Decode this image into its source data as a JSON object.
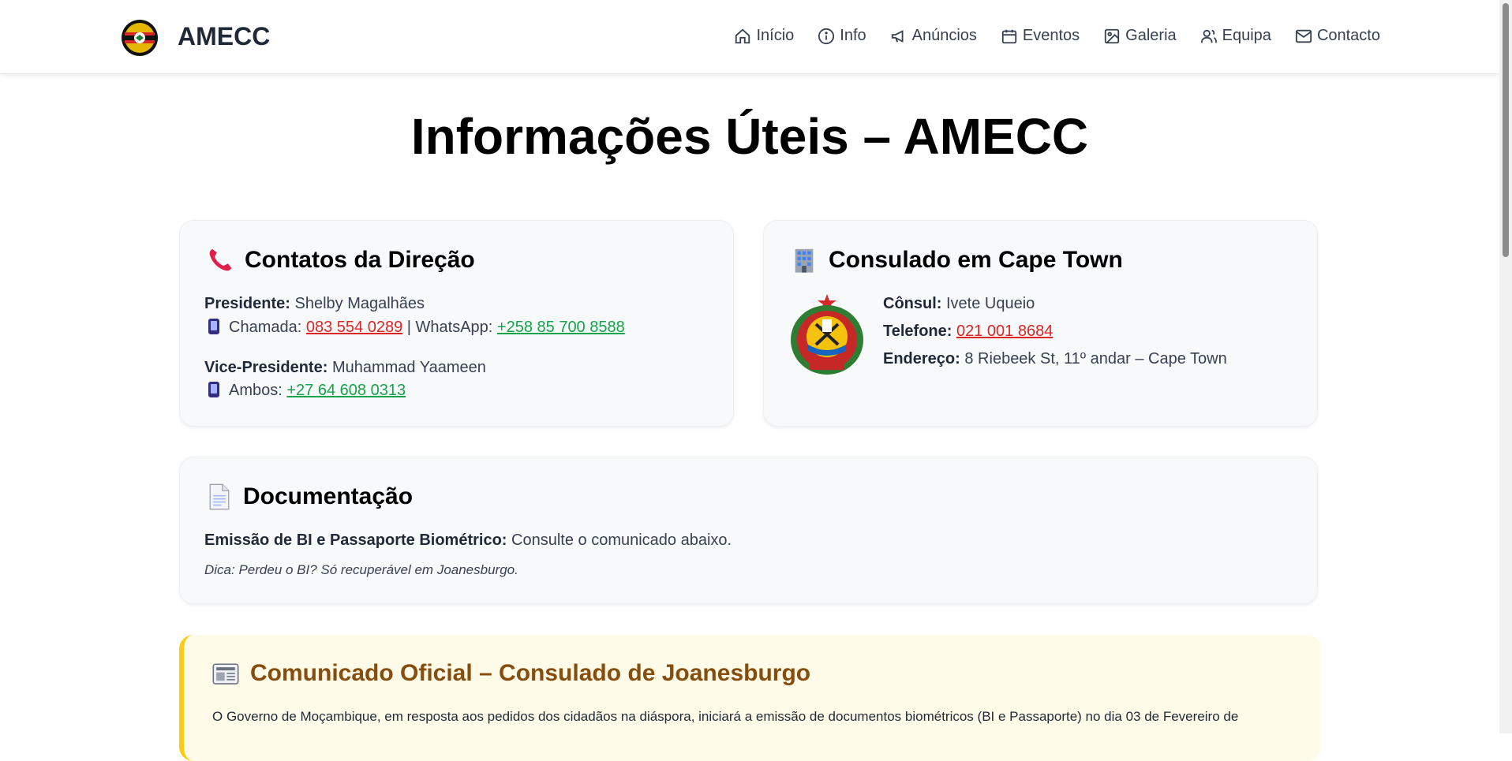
{
  "header": {
    "brand": "AMECC",
    "logo_icon": "amecc-logo-icon",
    "nav": [
      {
        "label": "Início",
        "icon": "home-icon"
      },
      {
        "label": "Info",
        "icon": "info-icon"
      },
      {
        "label": "Anúncios",
        "icon": "megaphone-icon"
      },
      {
        "label": "Eventos",
        "icon": "calendar-icon"
      },
      {
        "label": "Galeria",
        "icon": "image-icon"
      },
      {
        "label": "Equipa",
        "icon": "users-icon"
      },
      {
        "label": "Contacto",
        "icon": "mail-icon"
      }
    ]
  },
  "page": {
    "title": "Informações Úteis – AMECC"
  },
  "direcao": {
    "title": "Contatos da Direção",
    "icon": "telephone-receiver-icon",
    "presidente_label": "Presidente:",
    "presidente_name": "Shelby Magalhães",
    "chamada_label": "Chamada:",
    "chamada_number": "083 554 0289",
    "separator": "|",
    "whatsapp_label": "WhatsApp:",
    "whatsapp_number": "+258 85 700 8588",
    "vice_label": "Vice-Presidente:",
    "vice_name": "Muhammad Yaameen",
    "ambos_label": "Ambos:",
    "ambos_number": "+27 64 608 0313"
  },
  "consulado": {
    "title": "Consulado em Cape Town",
    "icon": "office-building-icon",
    "emblem_icon": "mozambique-emblem-icon",
    "consul_label": "Cônsul:",
    "consul_name": "Ivete Uqueio",
    "telefone_label": "Telefone:",
    "telefone_number": "021 001 8684",
    "endereco_label": "Endereço:",
    "endereco_value": "8 Riebeek St, 11º andar – Cape Town"
  },
  "documentacao": {
    "title": "Documentação",
    "icon": "document-icon",
    "emissao_label": "Emissão de BI e Passaporte Biométrico:",
    "emissao_value": "Consulte o comunicado abaixo.",
    "tip": "Dica: Perdeu o BI? Só recuperável em Joanesburgo."
  },
  "comunicado": {
    "title": "Comunicado Oficial – Consulado de Joanesburgo",
    "icon": "newspaper-icon",
    "text": "O Governo de Moçambique, em resposta aos pedidos dos cidadãos na diáspora, iniciará a emissão de documentos biométricos (BI e Passaporte) no dia 03 de Fevereiro de"
  },
  "colors": {
    "link_red": "#dc2626",
    "link_green": "#16a34a",
    "notice_bg": "#fefbe8",
    "notice_border": "#facc15",
    "notice_title": "#854d0e"
  }
}
